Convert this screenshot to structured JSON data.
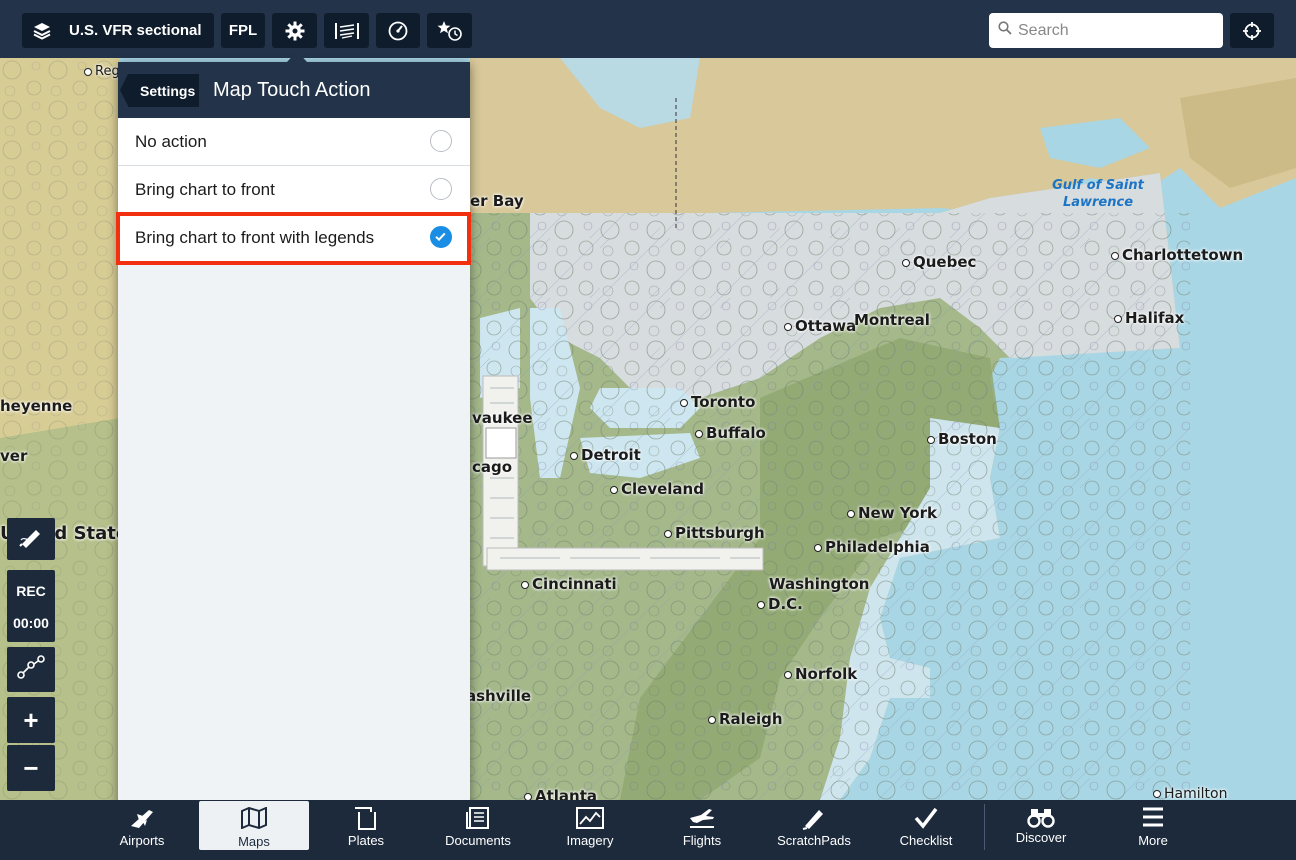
{
  "toolbar": {
    "layers_label": "U.S. VFR sectional",
    "fpl_label": "FPL",
    "search_placeholder": "Search"
  },
  "popover": {
    "back_label": "Settings",
    "title": "Map Touch Action",
    "options": [
      {
        "label": "No action",
        "selected": false
      },
      {
        "label": "Bring chart to front",
        "selected": false
      },
      {
        "label": "Bring chart to front with legends",
        "selected": true
      }
    ]
  },
  "map": {
    "labels": {
      "regina": "Reg",
      "thunder_bay": "er Bay",
      "cheyenne": "heyenne",
      "denver": "ver",
      "milwaukee": "vaukee",
      "chicago": "cago",
      "united_states": "United States",
      "nashville": "ashville",
      "atlanta": "Atlanta",
      "quebec": "Quebec",
      "charlottetown": "Charlottetown",
      "ottawa": "Ottawa",
      "montreal": "Montreal",
      "halifax": "Halifax",
      "toronto": "Toronto",
      "buffalo": "Buffalo",
      "detroit": "Detroit",
      "boston": "Boston",
      "cleveland": "Cleveland",
      "new_york": "New York",
      "pittsburgh": "Pittsburgh",
      "philadelphia": "Philadelphia",
      "cincinnati": "Cincinnati",
      "washington": "Washington",
      "dc": "D.C.",
      "norfolk": "Norfolk",
      "raleigh": "Raleigh",
      "hamilton": "Hamilton",
      "gulf_line1": "Gulf of Saint",
      "gulf_line2": "Lawrence"
    }
  },
  "tools": {
    "rec_label": "REC",
    "timer": "00:00",
    "zoom_in": "+",
    "zoom_out": "−"
  },
  "bottom_nav": [
    {
      "label": "Airports",
      "icon": "plane-icon"
    },
    {
      "label": "Maps",
      "icon": "map-icon",
      "active": true
    },
    {
      "label": "Plates",
      "icon": "plates-icon"
    },
    {
      "label": "Documents",
      "icon": "documents-icon"
    },
    {
      "label": "Imagery",
      "icon": "imagery-icon"
    },
    {
      "label": "Flights",
      "icon": "flights-icon"
    },
    {
      "label": "ScratchPads",
      "icon": "pencil-icon"
    },
    {
      "label": "Checklist",
      "icon": "checkmark-icon"
    },
    {
      "label": "Discover",
      "icon": "binoculars-icon"
    },
    {
      "label": "More",
      "icon": "menu-icon"
    }
  ],
  "colors": {
    "toolbar_bg": "#23344a",
    "button_bg": "#0f1c2c",
    "selected_radio": "#1a8ee5",
    "highlight_border": "#f2300f",
    "ocean": "#a9d6e5"
  }
}
